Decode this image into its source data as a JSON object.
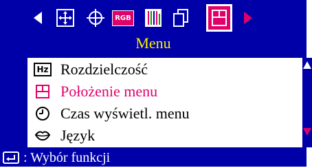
{
  "colors": {
    "background": "#0000a8",
    "panel": "#ffffff",
    "accent_selected": "#e0006a",
    "title_yellow": "#f6f000"
  },
  "toolbar": {
    "icons": [
      "left-arrow-icon",
      "position-icon",
      "geometry-icon",
      "rgb-icon",
      "color-bars-icon",
      "copy-icon",
      "menu-icon",
      "right-arrow-icon"
    ],
    "rgb_text": "RGB"
  },
  "header": {
    "title": "Menu"
  },
  "menu": {
    "items": [
      {
        "icon": "hz-icon",
        "icon_text": "Hz",
        "label": "Rozdzielczość",
        "selected": false
      },
      {
        "icon": "menu-position-icon",
        "label": "Położenie menu",
        "selected": true
      },
      {
        "icon": "clock-icon",
        "label": "Czas wyświetl. menu",
        "selected": false
      },
      {
        "icon": "lips-icon",
        "label": "Język",
        "selected": false
      }
    ]
  },
  "footer": {
    "label": ": Wybór funkcji",
    "icon": "enter-icon"
  }
}
